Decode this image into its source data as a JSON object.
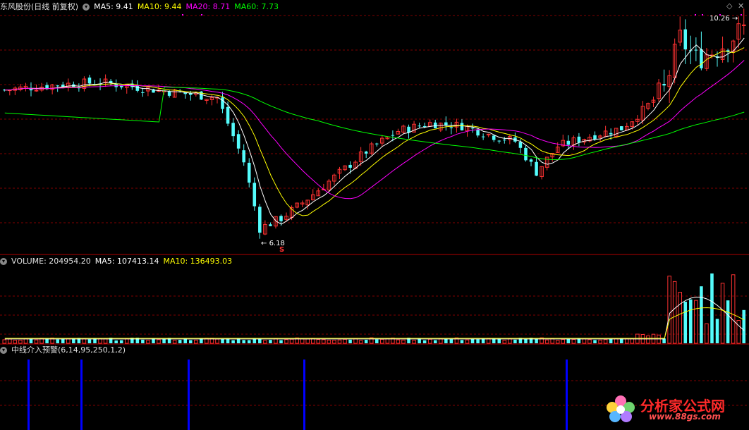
{
  "main_header": {
    "stock": "东风股份(日线 前复权)",
    "ma5": "MA5: 9.41",
    "ma10": "MA10: 9.44",
    "ma20": "MA20: 8.71",
    "ma60": "MA60: 7.73"
  },
  "volume_header": {
    "volume": "VOLUME: 204954.20",
    "ma5": "MA5: 107413.14",
    "ma10": "MA10: 136493.03"
  },
  "indicator_header": {
    "title": "中线介入预警(6,14,95,250,1,2)"
  },
  "annotations": {
    "high_label": "10.26",
    "low_label": "6.18",
    "s_marker": "S"
  },
  "watermark": {
    "name": "分析家公式网",
    "url": "www.88gs.com"
  },
  "colors": {
    "up": "#ff3232",
    "down": "#54fcfc",
    "ma5": "#ffffff",
    "ma10": "#ffff00",
    "ma20": "#ff00ff",
    "ma60": "#00ff00",
    "grid": "#800000",
    "signal": "#0000ff"
  },
  "chart_data": {
    "type": "candlestick",
    "x_start_label": "",
    "high": 10.26,
    "low": 6.18,
    "signals_at_fraction": [
      0.037,
      0.107,
      0.25,
      0.405,
      0.755
    ]
  }
}
